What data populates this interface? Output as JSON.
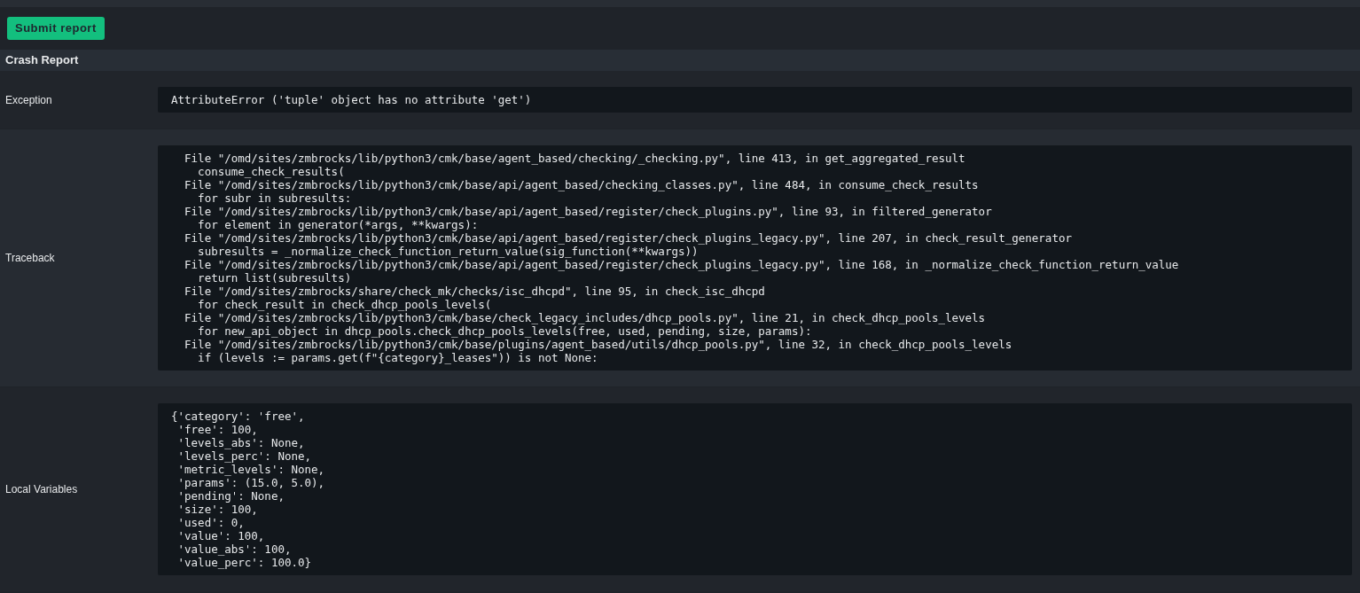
{
  "submit_button": {
    "label": "Submit report"
  },
  "section": {
    "title": "Crash Report"
  },
  "rows": [
    {
      "label": "Exception",
      "value": "AttributeError ('tuple' object has no attribute 'get')"
    },
    {
      "label": "Traceback",
      "value": "  File \"/omd/sites/zmbrocks/lib/python3/cmk/base/agent_based/checking/_checking.py\", line 413, in get_aggregated_result\n    consume_check_results(\n  File \"/omd/sites/zmbrocks/lib/python3/cmk/base/api/agent_based/checking_classes.py\", line 484, in consume_check_results\n    for subr in subresults:\n  File \"/omd/sites/zmbrocks/lib/python3/cmk/base/api/agent_based/register/check_plugins.py\", line 93, in filtered_generator\n    for element in generator(*args, **kwargs):\n  File \"/omd/sites/zmbrocks/lib/python3/cmk/base/api/agent_based/register/check_plugins_legacy.py\", line 207, in check_result_generator\n    subresults = _normalize_check_function_return_value(sig_function(**kwargs))\n  File \"/omd/sites/zmbrocks/lib/python3/cmk/base/api/agent_based/register/check_plugins_legacy.py\", line 168, in _normalize_check_function_return_value\n    return list(subresults)\n  File \"/omd/sites/zmbrocks/share/check_mk/checks/isc_dhcpd\", line 95, in check_isc_dhcpd\n    for check_result in check_dhcp_pools_levels(\n  File \"/omd/sites/zmbrocks/lib/python3/cmk/base/check_legacy_includes/dhcp_pools.py\", line 21, in check_dhcp_pools_levels\n    for new_api_object in dhcp_pools.check_dhcp_pools_levels(free, used, pending, size, params):\n  File \"/omd/sites/zmbrocks/lib/python3/cmk/base/plugins/agent_based/utils/dhcp_pools.py\", line 32, in check_dhcp_pools_levels\n    if (levels := params.get(f\"{category}_leases\")) is not None:"
    },
    {
      "label": "Local Variables",
      "value": "{'category': 'free',\n 'free': 100,\n 'levels_abs': None,\n 'levels_perc': None,\n 'metric_levels': None,\n 'params': (15.0, 5.0),\n 'pending': None,\n 'size': 100,\n 'used': 0,\n 'value': 100,\n 'value_abs': 100,\n 'value_perc': 100.0}"
    }
  ]
}
